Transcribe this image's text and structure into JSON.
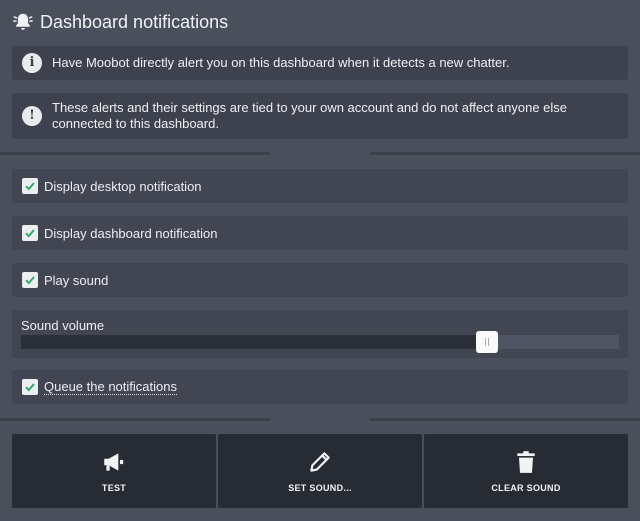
{
  "header": {
    "title": "Dashboard notifications",
    "icon": "bell-icon"
  },
  "info": [
    {
      "icon": "info-icon",
      "text": "Have Moobot directly alert you on this dashboard when it detects a new chatter."
    },
    {
      "icon": "exclamation-icon",
      "text": "These alerts and their settings are tied to your own account and do not affect anyone else connected to this dashboard."
    }
  ],
  "options": [
    {
      "label": "Display desktop notification",
      "checked": true
    },
    {
      "label": "Display dashboard notification",
      "checked": true
    },
    {
      "label": "Play sound",
      "checked": true
    }
  ],
  "volume": {
    "label": "Sound volume",
    "value": 0.78
  },
  "queue": {
    "label": "Queue the notifications",
    "checked": true
  },
  "buttons": [
    {
      "label": "TEST",
      "icon": "megaphone-icon"
    },
    {
      "label": "SET SOUND...",
      "icon": "pencil-icon"
    },
    {
      "label": "CLEAR SOUND",
      "icon": "trash-icon"
    }
  ],
  "colors": {
    "check": "#3aa76d",
    "background": "#4a4f5c",
    "button": "#272b34"
  }
}
